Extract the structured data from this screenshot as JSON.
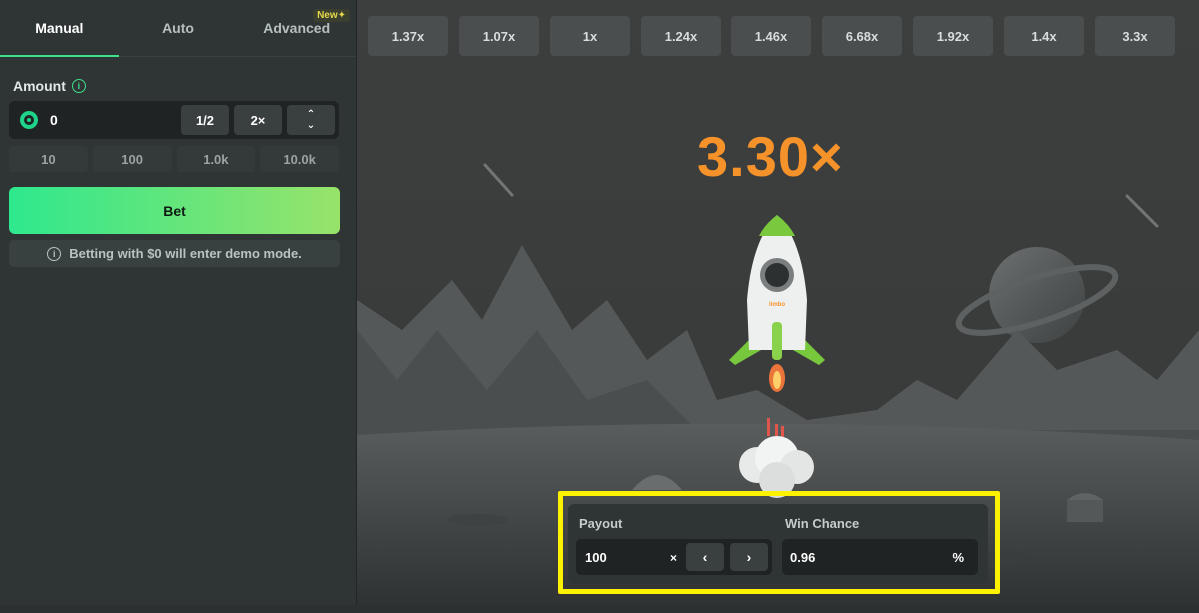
{
  "tabs": [
    {
      "label": "Manual"
    },
    {
      "label": "Auto"
    },
    {
      "label": "Advanced",
      "badge": "New✦"
    }
  ],
  "amount": {
    "label": "Amount",
    "info_glyph": "i",
    "value": "0",
    "half_label": "1/2",
    "double_label": "2×",
    "up_glyph": "⌃",
    "down_glyph": "⌄"
  },
  "presets": [
    "10",
    "100",
    "1.0k",
    "10.0k"
  ],
  "bet": {
    "label": "Bet",
    "demo_note": "Betting with $0 will enter demo mode."
  },
  "history": [
    "1.37x",
    "1.07x",
    "1x",
    "1.24x",
    "1.46x",
    "6.68x",
    "1.92x",
    "1.4x",
    "3.3x"
  ],
  "game": {
    "multiplier": "3.30×",
    "rocket_brand": "limbo",
    "accent_color": "#f6922a"
  },
  "controls": {
    "payout_label": "Payout",
    "payout_value": "100",
    "payout_suffix": "×",
    "prev_glyph": "‹",
    "next_glyph": "›",
    "win_chance_label": "Win Chance",
    "win_chance_value": "0.96",
    "win_chance_suffix": "%"
  },
  "colors": {
    "green_accent": "#3fe08c",
    "bet_gradient_start": "#2ee88e",
    "bet_gradient_end": "#98e36a",
    "highlight": "#fff200"
  }
}
